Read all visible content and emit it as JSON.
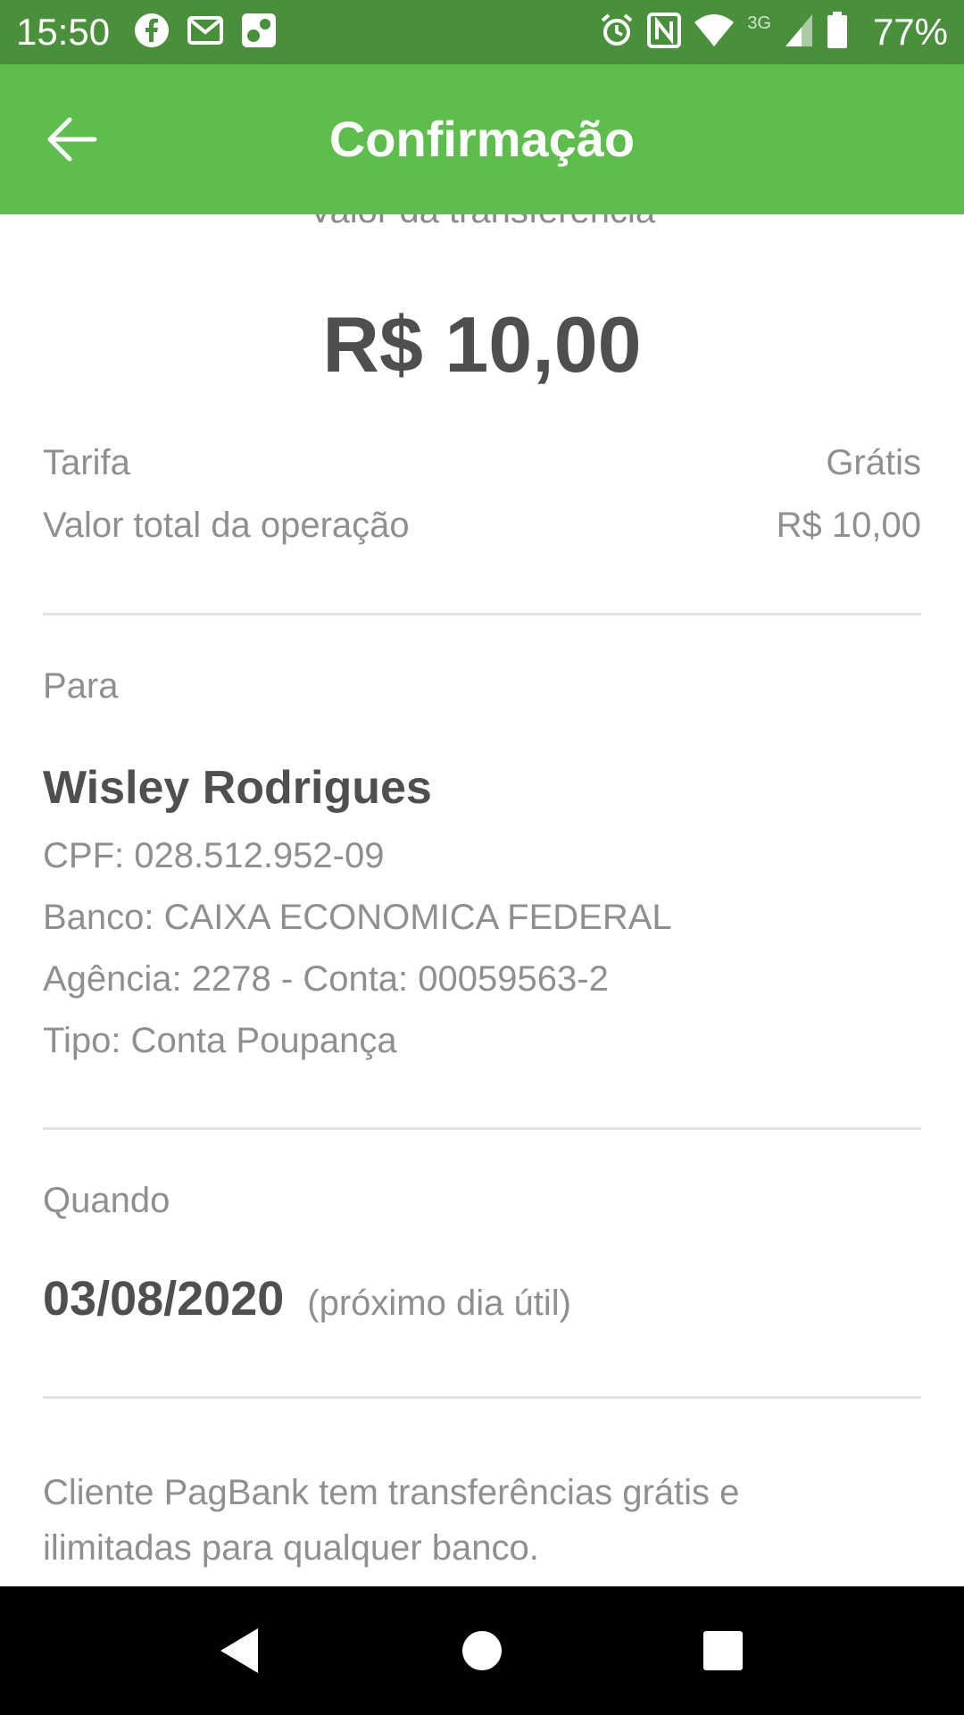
{
  "status_bar": {
    "time": "15:50",
    "left_icons": [
      "facebook-icon",
      "gmail-icon",
      "app-notification-icon"
    ],
    "right_icons": [
      "alarm-icon",
      "nfc-icon",
      "wifi-icon",
      "signal-icon",
      "battery-icon"
    ],
    "network": "3G",
    "battery": "77%"
  },
  "app_bar": {
    "title": "Confirmação",
    "background": "#5fbd4e"
  },
  "transfer": {
    "caption": "Valor da transferência",
    "amount": "R$ 10,00",
    "fee_label": "Tarifa",
    "fee_value": "Grátis",
    "total_label": "Valor total da operação",
    "total_value": "R$ 10,00"
  },
  "recipient": {
    "section_label": "Para",
    "name": "Wisley Rodrigues",
    "cpf": "CPF: 028.512.952-09",
    "bank": "Banco: CAIXA ECONOMICA FEDERAL",
    "account": "Agência: 2278 - Conta: 00059563-2",
    "type": "Tipo: Conta Poupança"
  },
  "schedule": {
    "section_label": "Quando",
    "date": "03/08/2020",
    "note": "(próximo dia útil)"
  },
  "info": {
    "text": "Cliente PagBank tem transferências grátis e ilimitadas para qualquer banco."
  },
  "nav_bar": {
    "buttons": [
      "back-triangle-icon",
      "home-circle-icon",
      "recents-square-icon"
    ]
  }
}
